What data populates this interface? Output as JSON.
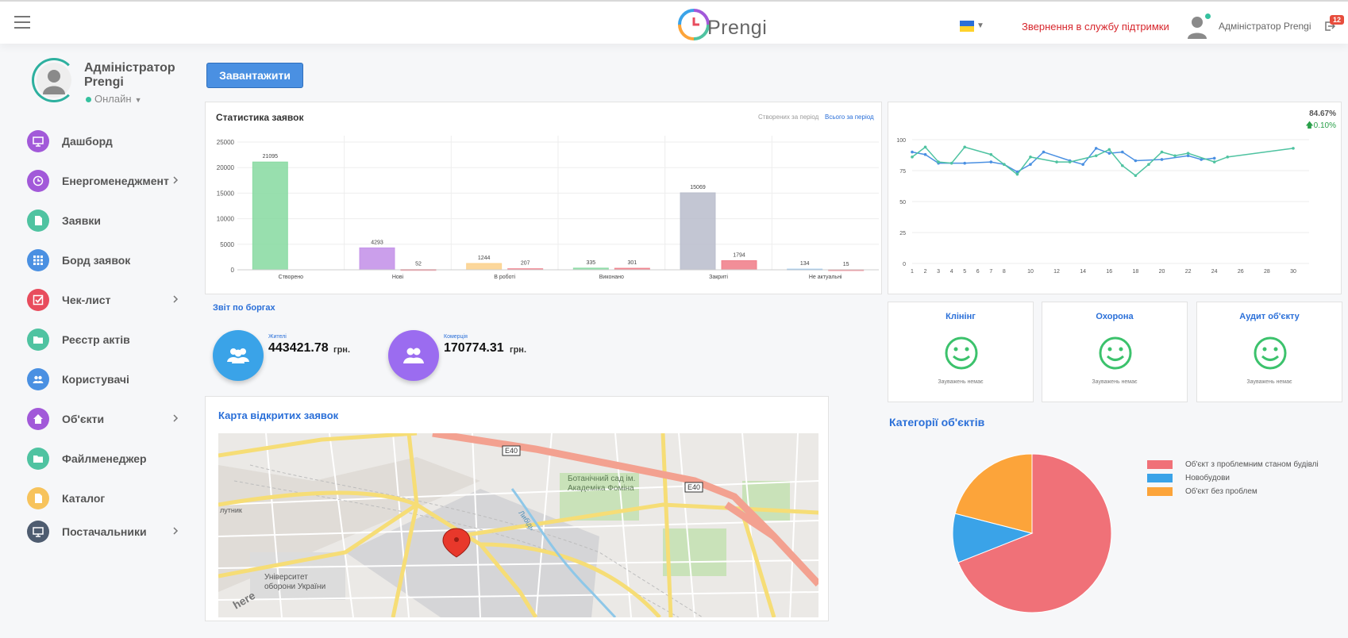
{
  "header": {
    "logo_text": "Prengi",
    "support_link": "Звернення в службу підтримки",
    "username": "Адміністратор Prengi",
    "notification_count": "12"
  },
  "sidebar": {
    "user_name": "Адміністратор Prengi",
    "status": "Онлайн",
    "items": [
      {
        "label": "Дашборд",
        "color": "#a259d9",
        "icon": "monitor-icon",
        "chevron": false
      },
      {
        "label": "Енергоменеджмент",
        "color": "#a259d9",
        "icon": "clock-icon",
        "chevron": true
      },
      {
        "label": "Заявки",
        "color": "#4fc3a1",
        "icon": "document-icon",
        "chevron": false
      },
      {
        "label": "Борд заявок",
        "color": "#4a90e2",
        "icon": "grid-icon",
        "chevron": false
      },
      {
        "label": "Чек-лист",
        "color": "#e84c5d",
        "icon": "checkbox-icon",
        "chevron": true
      },
      {
        "label": "Реєстр актів",
        "color": "#4fc3a1",
        "icon": "folder-icon",
        "chevron": false
      },
      {
        "label": "Користувачі",
        "color": "#4a90e2",
        "icon": "users-icon",
        "chevron": false
      },
      {
        "label": "Об'єкти",
        "color": "#a259d9",
        "icon": "home-icon",
        "chevron": true
      },
      {
        "label": "Файлменеджер",
        "color": "#4fc3a1",
        "icon": "folder-icon",
        "chevron": false
      },
      {
        "label": "Каталог",
        "color": "#f7c35c",
        "icon": "document-icon",
        "chevron": false
      },
      {
        "label": "Постачальники",
        "color": "#4e5c70",
        "icon": "monitor-icon",
        "chevron": true
      }
    ]
  },
  "toolbar": {
    "download_label": "Завантажити"
  },
  "stats": {
    "title": "Статистика заявок",
    "tab_created": "Створених за період",
    "tab_total": "Всього за період"
  },
  "line_widget": {
    "percent": "84.67%",
    "change": "0.10%"
  },
  "debt": {
    "title": "Звіт по боргах",
    "residents_label": "Жителі",
    "residents_value": "443421.78",
    "commerce_label": "Комерція",
    "commerce_value": "170774.31",
    "currency": "грн."
  },
  "status_cards": [
    {
      "title": "Клінінг",
      "note": "Зауважень немає"
    },
    {
      "title": "Охорона",
      "note": "Зауважень немає"
    },
    {
      "title": "Аудит об'єкту",
      "note": "Зауважень немає"
    }
  ],
  "map": {
    "title": "Карта відкритих заявок",
    "labels": [
      "E40",
      "E40",
      "Ботанічний сад ім.",
      "Академіка Фоміна",
      "Університет",
      "оборони України",
      "Либідь",
      "лутник",
      "here"
    ]
  },
  "categories": {
    "title": "Категорії об'єктів"
  },
  "chart_data": [
    {
      "type": "bar",
      "title": "Статистика заявок",
      "categories": [
        "Створено",
        "Нові",
        "В роботі",
        "Виконано",
        "Закриті",
        "Не актуальні"
      ],
      "ylim": [
        0,
        25000
      ],
      "yticks": [
        0,
        5000,
        10000,
        15000,
        20000,
        25000
      ],
      "grid": true,
      "series": [
        {
          "values": [
            21095,
            4293,
            1244,
            335,
            15069,
            134
          ],
          "colors": [
            "#86d9a0",
            "#c28ee8",
            "#fcd08a",
            "#86d9a0",
            "#b8bccb",
            "#90c3ee"
          ]
        },
        {
          "values": [
            null,
            52,
            207,
            301,
            1794,
            15
          ],
          "colors": [
            "#f07a86",
            "#f07a86",
            "#f07a86",
            "#f07a86",
            "#f07a86",
            "#f07a86"
          ]
        }
      ]
    },
    {
      "type": "line",
      "x": [
        1,
        2,
        3,
        4,
        5,
        6,
        7,
        8,
        10,
        12,
        14,
        16,
        18,
        20,
        22,
        24,
        26,
        28,
        30
      ],
      "xticks": [
        1,
        2,
        3,
        4,
        5,
        6,
        7,
        8,
        10,
        12,
        14,
        16,
        18,
        20,
        22,
        24,
        26,
        28,
        30
      ],
      "ylim": [
        0,
        100
      ],
      "yticks": [
        0,
        25,
        50,
        75,
        100
      ],
      "grid": true,
      "series": [
        {
          "color": "#4a90e2",
          "points": [
            [
              1,
              90
            ],
            [
              2,
              88
            ],
            [
              3,
              81
            ],
            [
              5,
              81
            ],
            [
              7,
              82
            ],
            [
              8,
              80
            ],
            [
              9,
              74
            ],
            [
              10,
              80
            ],
            [
              11,
              90
            ],
            [
              13,
              83
            ],
            [
              14,
              80
            ],
            [
              15,
              93
            ],
            [
              16,
              89
            ],
            [
              17,
              90
            ],
            [
              18,
              83
            ],
            [
              20,
              84
            ],
            [
              22,
              87
            ],
            [
              23,
              84
            ],
            [
              24,
              85
            ]
          ]
        },
        {
          "color": "#4fc3a1",
          "points": [
            [
              1,
              86
            ],
            [
              2,
              94
            ],
            [
              3,
              82
            ],
            [
              4,
              81
            ],
            [
              5,
              94
            ],
            [
              7,
              88
            ],
            [
              8,
              80
            ],
            [
              9,
              72
            ],
            [
              10,
              86
            ],
            [
              12,
              82
            ],
            [
              13,
              82
            ],
            [
              15,
              87
            ],
            [
              16,
              92
            ],
            [
              17,
              79
            ],
            [
              18,
              71
            ],
            [
              19,
              80
            ],
            [
              20,
              90
            ],
            [
              21,
              87
            ],
            [
              22,
              89
            ],
            [
              24,
              82
            ],
            [
              25,
              86
            ],
            [
              30,
              93
            ]
          ]
        }
      ]
    },
    {
      "type": "pie",
      "title": "Категорії об'єктів",
      "legend": "right",
      "slices": [
        {
          "label": "Об'єкт з проблемним станом будівлі",
          "value": 69,
          "color": "#f07178"
        },
        {
          "label": "Новобудови",
          "value": 10,
          "color": "#3aa3e8"
        },
        {
          "label": "Об'єкт без проблем",
          "value": 21,
          "color": "#fca43a"
        }
      ]
    }
  ]
}
